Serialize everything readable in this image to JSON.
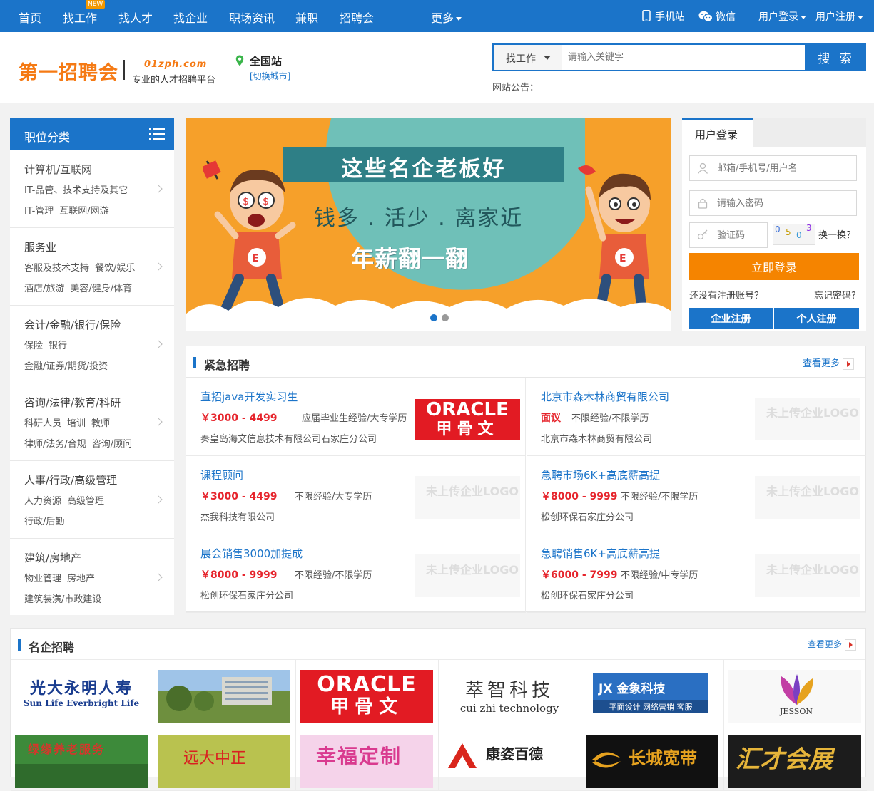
{
  "topnav": {
    "items": [
      "首页",
      "找工作",
      "找人才",
      "找企业",
      "职场资讯",
      "兼职",
      "招聘会",
      "更多"
    ],
    "new_badge": "NEW",
    "mobile": "手机站",
    "wechat": "微信",
    "login": "用户登录",
    "register": "用户注册"
  },
  "header": {
    "logo_text": "第一招聘会",
    "logo_url": "01zph.com",
    "logo_slogan": "专业的人才招聘平台",
    "location": "全国站",
    "switch_city": "[切换城市]",
    "search_type": "找工作",
    "search_placeholder": "请输入关键字",
    "search_button": "搜 索",
    "notice_label": "网站公告："
  },
  "categories": {
    "heading": "职位分类",
    "groups": [
      {
        "title": "计算机/互联网",
        "line1": [
          "IT-品管、技术支持及其它"
        ],
        "line2": [
          "IT-管理",
          "互联网/网游"
        ]
      },
      {
        "title": "服务业",
        "line1": [
          "客服及技术支持",
          "餐饮/娱乐"
        ],
        "line2": [
          "酒店/旅游",
          "美容/健身/体育"
        ]
      },
      {
        "title": "会计/金融/银行/保险",
        "line1": [
          "保险",
          "银行"
        ],
        "line2": [
          "金融/证券/期货/投资"
        ]
      },
      {
        "title": "咨询/法律/教育/科研",
        "line1": [
          "科研人员",
          "培训",
          "教师"
        ],
        "line2": [
          "律师/法务/合规",
          "咨询/顾问"
        ]
      },
      {
        "title": "人事/行政/高级管理",
        "line1": [
          "人力资源",
          "高级管理"
        ],
        "line2": [
          "行政/后勤"
        ]
      },
      {
        "title": "建筑/房地产",
        "line1": [
          "物业管理",
          "房地产"
        ],
        "line2": [
          "建筑装潢/市政建设"
        ]
      }
    ]
  },
  "banner": {
    "ribbon": "这些名企老板好",
    "slogan1": "钱多 . 活少 . 离家近",
    "slogan2": "年薪翻一翻"
  },
  "login": {
    "tab": "用户登录",
    "user_placeholder": "邮箱/手机号/用户名",
    "password_placeholder": "请输入密码",
    "captcha_placeholder": "验证码",
    "captcha_chars": [
      "0",
      "5",
      "0",
      "3"
    ],
    "refresh": "换一换？",
    "submit": "立即登录",
    "no_account": "还没有注册账号？",
    "forgot": "忘记密码?",
    "company_register": "企业注册",
    "personal_register": "个人注册"
  },
  "urgent": {
    "title": "紧急招聘",
    "more": "查看更多",
    "nologo_text": "未上传企业LOGO",
    "jobs": [
      {
        "title": "直招java开发实习生",
        "salary": "￥3000 - 4499",
        "req": "应届毕业生经验/大专学历",
        "company": "秦皇岛海文信息技术有限公司石家庄分公司",
        "logo": "oracle"
      },
      {
        "title": "北京市森木林商贸有限公司",
        "salary": "面议",
        "req": "不限经验/不限学历",
        "company": "北京市森木林商贸有限公司",
        "logo": "none"
      },
      {
        "title": "课程顾问",
        "salary": "￥3000 - 4499",
        "req": "不限经验/大专学历",
        "company": "杰我科技有限公司",
        "logo": "none"
      },
      {
        "title": "急聘市场6K+高底薪高提",
        "salary": "￥8000 - 9999",
        "req": "不限经验/不限学历",
        "company": "松创环保石家庄分公司",
        "logo": "none"
      },
      {
        "title": "展会销售3000加提成",
        "salary": "￥8000 - 9999",
        "req": "不限经验/不限学历",
        "company": "松创环保石家庄分公司",
        "logo": "none"
      },
      {
        "title": "急聘销售6K+高底薪高提",
        "salary": "￥6000 - 7999",
        "req": "不限经验/中专学历",
        "company": "松创环保石家庄分公司",
        "logo": "none"
      }
    ]
  },
  "famous": {
    "title": "名企招聘",
    "more": "查看更多",
    "row1": [
      {
        "cn": "光大永明人寿",
        "en": "Sun Life Everbright Life"
      },
      {
        "cn": "",
        "en": ""
      },
      {
        "cn": "ORACLE",
        "en": "甲骨文"
      },
      {
        "cn": "萃智科技",
        "en": "cui zhi technology"
      },
      {
        "cn": "JX 金象科技",
        "en": "平面设计 网络营销 客服"
      },
      {
        "cn": "JESSON",
        "en": ""
      }
    ],
    "row2": [
      {
        "cn": "绿缘养老服务"
      },
      {
        "cn": "远大中正"
      },
      {
        "cn": "幸福定制"
      },
      {
        "cn": "康姿百德"
      },
      {
        "cn": "长城宽带"
      },
      {
        "cn": "汇才会展"
      }
    ]
  },
  "colors": {
    "primary": "#1b74c9",
    "accent": "#f58400",
    "salary": "#e6242c"
  }
}
